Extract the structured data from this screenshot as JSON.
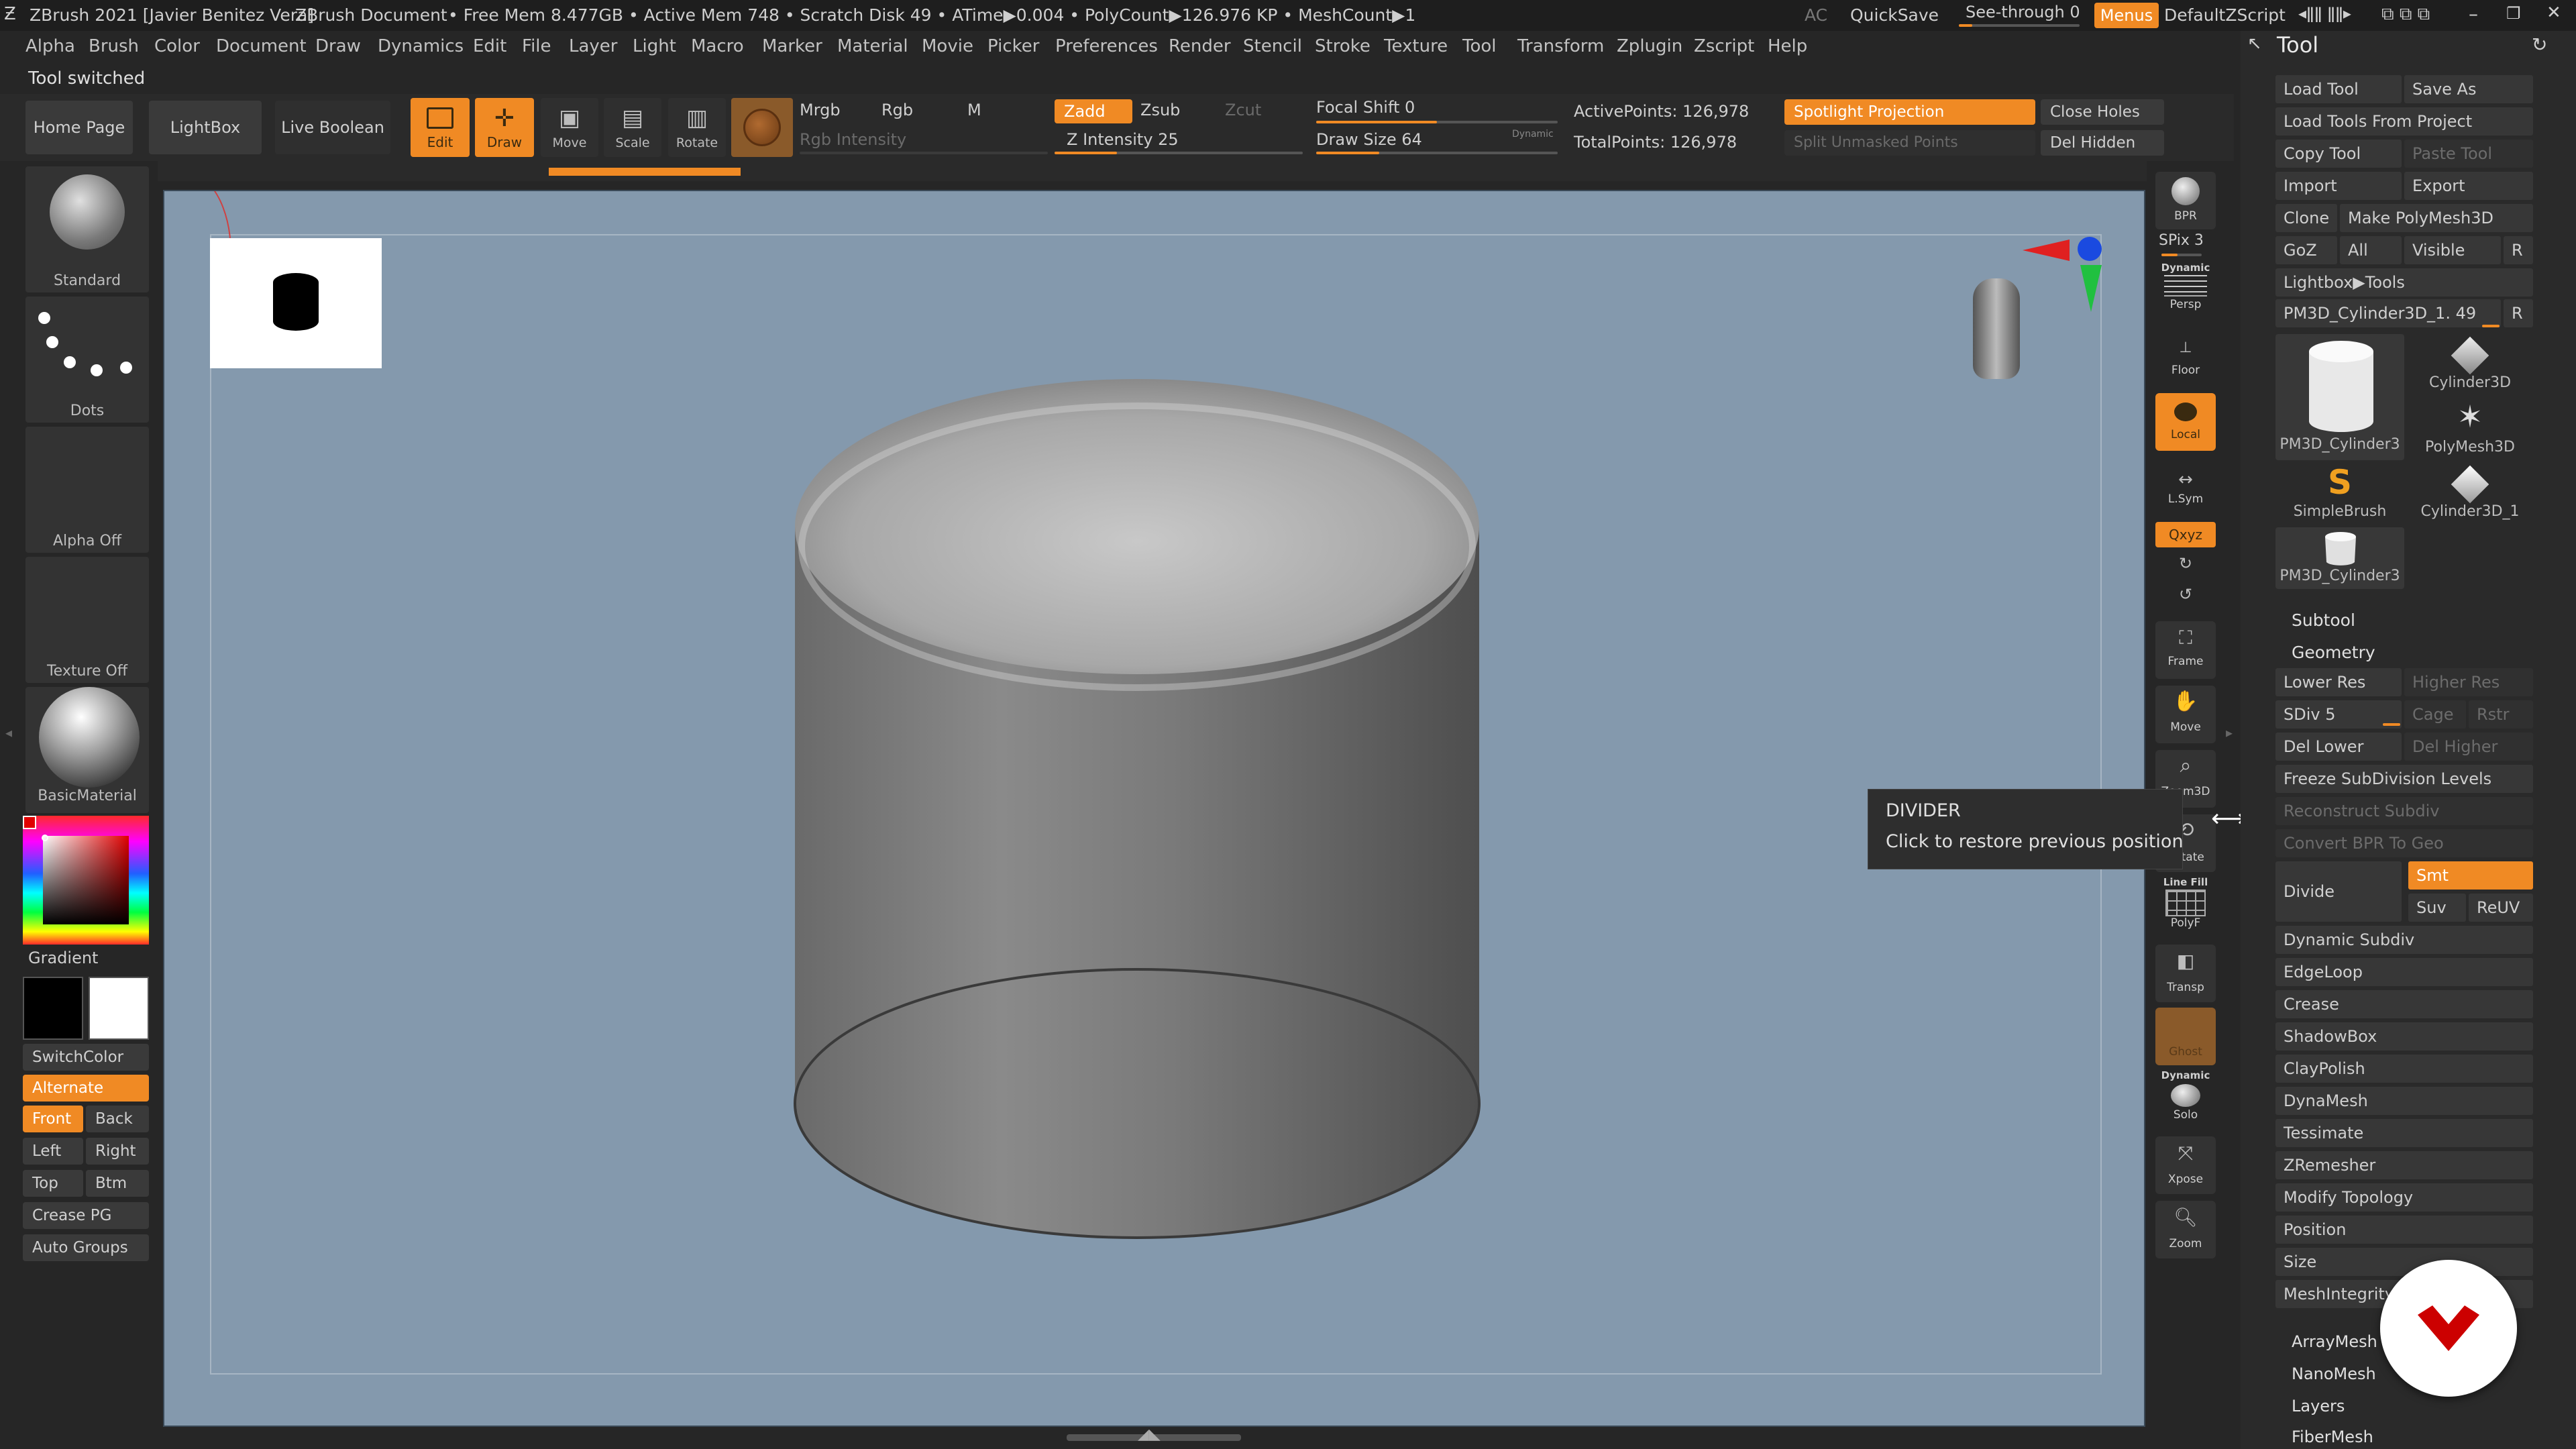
{
  "titlebar": {
    "app_title": "ZBrush 2021 [Javier Benitez Vera]",
    "document": "ZBrush Document",
    "status": "• Free Mem 8.477GB • Active Mem 748 • Scratch Disk 49 • ATime▶0.004 • PolyCount▶126.976 KP • MeshCount▶1",
    "ac": "AC",
    "quicksave": "QuickSave",
    "see_through": "See-through  0",
    "menus": "Menus",
    "script": "DefaultZScript"
  },
  "menu": [
    "Alpha",
    "Brush",
    "Color",
    "Document",
    "Draw",
    "Dynamics",
    "Edit",
    "File",
    "Layer",
    "Light",
    "Macro",
    "Marker",
    "Material",
    "Movie",
    "Picker",
    "Preferences",
    "Render",
    "Stencil",
    "Stroke",
    "Texture",
    "Tool",
    "Transform",
    "Zplugin",
    "Zscript",
    "Help"
  ],
  "notice": "Tool switched",
  "topshelf": {
    "home": "Home Page",
    "lightbox": "LightBox",
    "liveboolean": "Live Boolean",
    "edit": "Edit",
    "draw": "Draw",
    "move": "Move",
    "scale": "Scale",
    "rotate": "Rotate",
    "mrgb": "Mrgb",
    "rgb": "Rgb",
    "m": "M",
    "rgb_intensity": "Rgb Intensity",
    "zadd": "Zadd",
    "zsub": "Zsub",
    "zcut": "Zcut",
    "z_intensity": "Z Intensity 25",
    "focal_shift": "Focal Shift 0",
    "draw_size": "Draw Size 64",
    "dynamic": "Dynamic",
    "active_points": "ActivePoints: 126,978",
    "total_points": "TotalPoints: 126,978",
    "spotlight": "Spotlight Projection",
    "split_unmasked": "Split Unmasked Points",
    "close_holes": "Close Holes",
    "del_hidden": "Del Hidden",
    "z_intensity_value": 0.25,
    "focal_shift_value": 0.5,
    "draw_size_value": 0.26
  },
  "leftshelf": {
    "standard": "Standard",
    "dots": "Dots",
    "alpha": "Alpha Off",
    "texture": "Texture Off",
    "material": "BasicMaterial",
    "gradient": "Gradient",
    "switchcolor": "SwitchColor",
    "alternate": "Alternate",
    "front": "Front",
    "back": "Back",
    "left": "Left",
    "right": "Right",
    "top": "Top",
    "btm": "Btm",
    "crease_pg": "Crease PG",
    "auto_groups": "Auto Groups"
  },
  "rightshelf": {
    "bpr": "BPR",
    "spix": "SPix 3",
    "dynamic": "Dynamic",
    "persp": "Persp",
    "floor": "Floor",
    "local": "Local",
    "lsym": "L.Sym",
    "xyz": "Qxyz",
    "frame": "Frame",
    "move": "Move",
    "zoom3d": "Zoom3D",
    "rotate": "Rotate",
    "linefill": "Line Fill",
    "polyf": "PolyF",
    "transp": "Transp",
    "ghost": "Ghost",
    "solo_dynamic": "Dynamic",
    "solo": "Solo",
    "xpose": "Xpose",
    "zoom": "Zoom"
  },
  "tooltip": {
    "title": "DIVIDER",
    "body": "Click to restore previous position"
  },
  "tool": {
    "header": "Tool",
    "load_tool": "Load Tool",
    "save_as": "Save As",
    "load_from_project": "Load Tools From Project",
    "copy_tool": "Copy Tool",
    "paste_tool": "Paste Tool",
    "import": "Import",
    "export": "Export",
    "clone": "Clone",
    "make_polymesh": "Make PolyMesh3D",
    "goz": "GoZ",
    "all": "All",
    "visible": "Visible",
    "r": "R",
    "lightbox_tools": "Lightbox▶Tools",
    "current_tool": "PM3D_Cylinder3D_1. 49",
    "r2": "R",
    "thumbs": [
      "PM3D_Cylinder3",
      "Cylinder3D",
      "PolyMesh3D",
      "SimpleBrush",
      "Cylinder3D_1",
      "PM3D_Cylinder3"
    ],
    "subtool": "Subtool",
    "geometry": "Geometry",
    "lower_res": "Lower Res",
    "higher_res": "Higher Res",
    "sdiv": "SDiv 5",
    "cage": "Cage",
    "rstr": "Rstr",
    "del_lower": "Del Lower",
    "del_higher": "Del Higher",
    "freeze": "Freeze SubDivision Levels",
    "reconstruct": "Reconstruct Subdiv",
    "convert_bpr": "Convert BPR To Geo",
    "divide": "Divide",
    "smt": "Smt",
    "suv": "Suv",
    "reuv": "ReUV",
    "items": [
      "Dynamic Subdiv",
      "EdgeLoop",
      "Crease",
      "ShadowBox",
      "ClayPolish",
      "DynaMesh",
      "Tessimate",
      "ZRemesher",
      "Modify Topology",
      "Position",
      "Size",
      "MeshIntegrity"
    ],
    "sections": [
      "ArrayMesh",
      "NanoMesh",
      "Layers",
      "FiberMesh"
    ]
  },
  "colors": {
    "accent": "#f08a24",
    "canvas": "#8499ad",
    "brand_red": "#cc0000"
  }
}
